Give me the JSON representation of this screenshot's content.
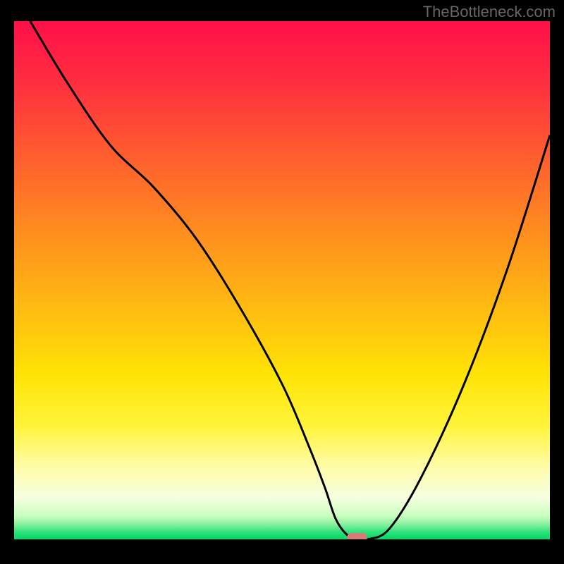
{
  "attribution": "TheBottleneck.com",
  "chart_data": {
    "type": "line",
    "title": "",
    "xlabel": "",
    "ylabel": "",
    "xlim": [
      0,
      100
    ],
    "ylim": [
      0,
      100
    ],
    "gradient_stops": [
      {
        "offset": 0.0,
        "color": "#ff1049"
      },
      {
        "offset": 0.12,
        "color": "#ff2f3f"
      },
      {
        "offset": 0.25,
        "color": "#ff5a30"
      },
      {
        "offset": 0.4,
        "color": "#ff8b1f"
      },
      {
        "offset": 0.55,
        "color": "#ffba12"
      },
      {
        "offset": 0.68,
        "color": "#ffe305"
      },
      {
        "offset": 0.78,
        "color": "#fff43a"
      },
      {
        "offset": 0.86,
        "color": "#fffca8"
      },
      {
        "offset": 0.92,
        "color": "#f5ffe0"
      },
      {
        "offset": 0.955,
        "color": "#c9ffc0"
      },
      {
        "offset": 0.97,
        "color": "#8cf2a0"
      },
      {
        "offset": 0.985,
        "color": "#34e27d"
      },
      {
        "offset": 1.0,
        "color": "#00d865"
      }
    ],
    "curve": {
      "x": [
        3,
        10,
        18,
        26,
        34,
        42,
        50,
        55,
        58,
        60,
        62,
        64,
        66,
        70,
        76,
        84,
        92,
        100
      ],
      "y": [
        100,
        88,
        76,
        68,
        58,
        45,
        30,
        18,
        10,
        4,
        1,
        0,
        0,
        2,
        12,
        30,
        52,
        78
      ]
    },
    "optimal_marker": {
      "x": 64,
      "y": 0,
      "color": "#d97a7a"
    }
  }
}
